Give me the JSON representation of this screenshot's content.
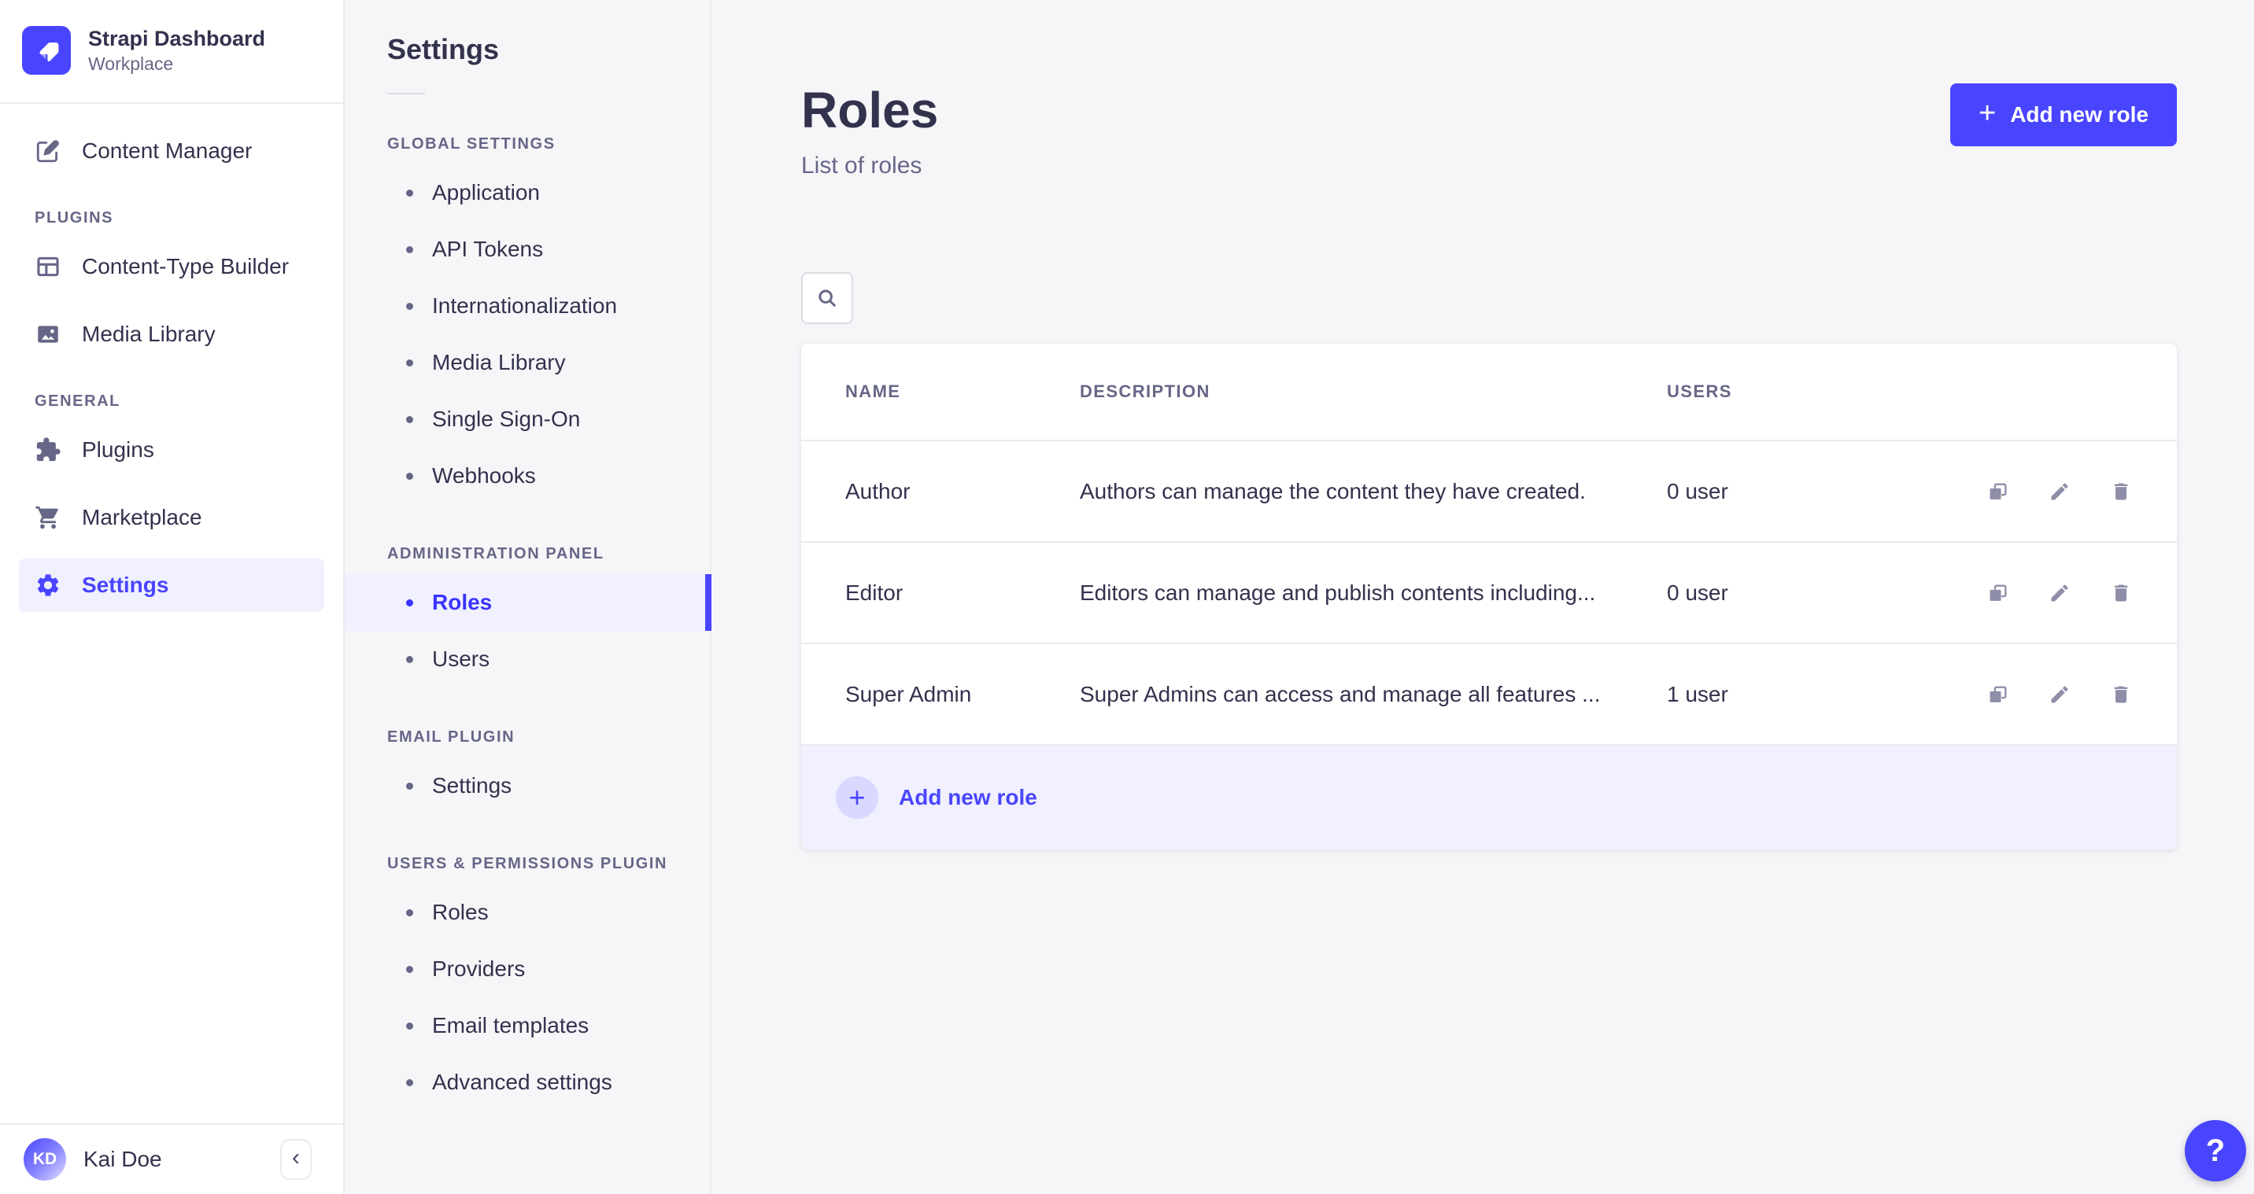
{
  "colors": {
    "primary": "#4945FF",
    "primary_light": "#F0F0FF",
    "primary_lighter": "#D9D8FF",
    "text_dark": "#32324D",
    "text_muted": "#666687",
    "icon_muted": "#8E8EA9",
    "border": "#EAEAEF",
    "page_bg": "#F6F6F9"
  },
  "sidebar": {
    "brand": {
      "title": "Strapi Dashboard",
      "subtitle": "Workplace"
    },
    "top_items": [
      {
        "label": "Content Manager",
        "icon": "content-manager-icon"
      }
    ],
    "sections": [
      {
        "title": "PLUGINS",
        "items": [
          {
            "label": "Content-Type Builder",
            "icon": "content-type-builder-icon"
          },
          {
            "label": "Media Library",
            "icon": "media-library-icon"
          }
        ]
      },
      {
        "title": "GENERAL",
        "items": [
          {
            "label": "Plugins",
            "icon": "plugins-icon"
          },
          {
            "label": "Marketplace",
            "icon": "marketplace-icon"
          },
          {
            "label": "Settings",
            "icon": "settings-icon",
            "active": true
          }
        ]
      }
    ],
    "footer": {
      "initials": "KD",
      "name": "Kai Doe",
      "collapse_icon": "‹"
    }
  },
  "subnav": {
    "title": "Settings",
    "sections": [
      {
        "title": "GLOBAL SETTINGS",
        "items": [
          {
            "label": "Application"
          },
          {
            "label": "API Tokens"
          },
          {
            "label": "Internationalization"
          },
          {
            "label": "Media Library"
          },
          {
            "label": "Single Sign-On"
          },
          {
            "label": "Webhooks"
          }
        ]
      },
      {
        "title": "ADMINISTRATION PANEL",
        "items": [
          {
            "label": "Roles",
            "active": true
          },
          {
            "label": "Users"
          }
        ]
      },
      {
        "title": "EMAIL PLUGIN",
        "items": [
          {
            "label": "Settings"
          }
        ]
      },
      {
        "title": "USERS & PERMISSIONS PLUGIN",
        "items": [
          {
            "label": "Roles"
          },
          {
            "label": "Providers"
          },
          {
            "label": "Email templates"
          },
          {
            "label": "Advanced settings"
          }
        ]
      }
    ]
  },
  "main": {
    "title": "Roles",
    "subtitle": "List of roles",
    "add_button_label": "Add new role",
    "plus_icon": "+",
    "table": {
      "headers": {
        "name": "NAME",
        "description": "DESCRIPTION",
        "users": "USERS"
      },
      "rows": [
        {
          "name": "Author",
          "description": "Authors can manage the content they have created.",
          "users": "0 user"
        },
        {
          "name": "Editor",
          "description": "Editors can manage and publish contents including...",
          "users": "0 user"
        },
        {
          "name": "Super Admin",
          "description": "Super Admins can access and manage all features ...",
          "users": "1 user"
        }
      ],
      "footer": {
        "label": "Add new role",
        "plus_icon": "+"
      }
    },
    "help_icon": "?"
  }
}
